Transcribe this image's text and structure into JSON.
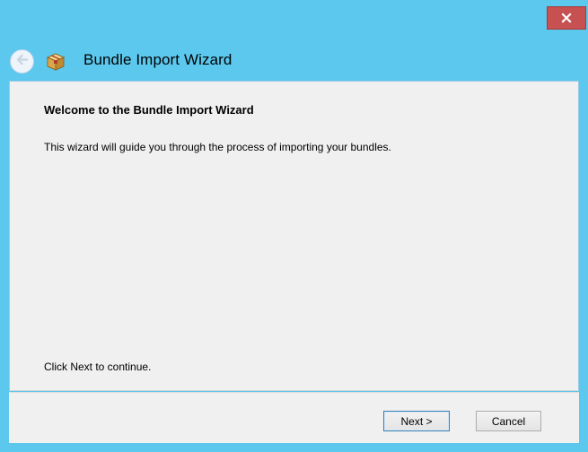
{
  "window": {
    "close_glyph": "x"
  },
  "header": {
    "title": "Bundle Import Wizard",
    "back_icon": "back-arrow-icon",
    "app_icon": "bundle-box-icon"
  },
  "main": {
    "heading": "Welcome to the Bundle Import Wizard",
    "description": "This wizard will guide you through the process of importing your bundles.",
    "hint": "Click Next to continue."
  },
  "footer": {
    "next_label": "Next >",
    "cancel_label": "Cancel"
  },
  "colors": {
    "frame": "#5cc8ee",
    "close_button": "#c75050",
    "panel": "#f0f0f0"
  }
}
